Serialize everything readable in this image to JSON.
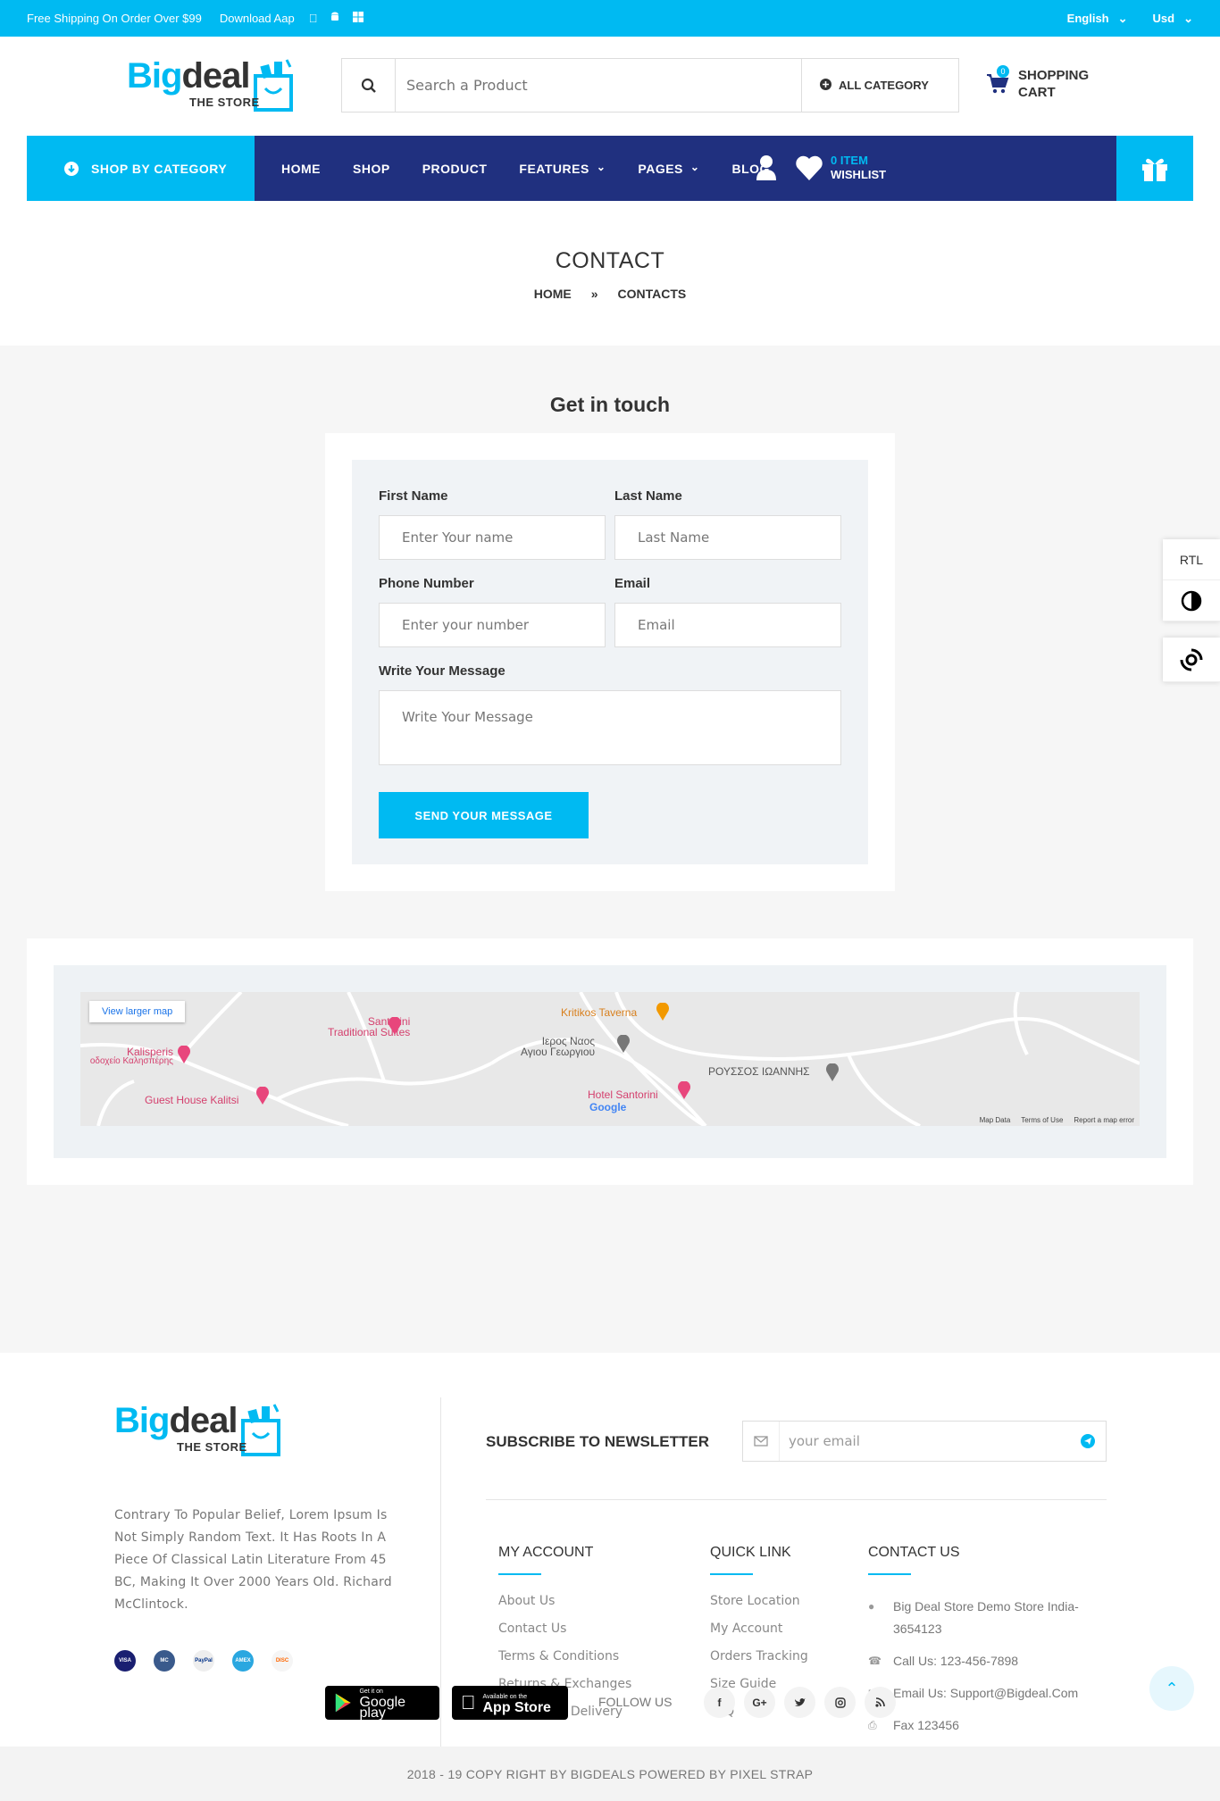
{
  "topbar": {
    "shipping": "Free Shipping On Order Over $99",
    "download": "Download Aap",
    "language": "English",
    "currency": "Usd"
  },
  "logo": {
    "big": "Big",
    "deal": "deal",
    "sub": "THE STORE"
  },
  "search": {
    "placeholder": "Search a Product",
    "category": "ALL CATEGORY"
  },
  "cart": {
    "count": "0",
    "line1": "SHOPPING",
    "line2": "CART"
  },
  "nav": {
    "shop_by_category": "SHOP BY CATEGORY",
    "items": [
      "HOME",
      "SHOP",
      "PRODUCT",
      "FEATURES",
      "PAGES",
      "BLOG"
    ],
    "wishlist_count": "0 ITEM",
    "wishlist_label": "WISHLIST"
  },
  "page": {
    "title": "CONTACT",
    "crumb_home": "HOME",
    "crumb_sep": "»",
    "crumb_current": "CONTACTS"
  },
  "form": {
    "heading": "Get in touch",
    "first_name_label": "First Name",
    "first_name_placeholder": "Enter Your name",
    "last_name_label": "Last Name",
    "last_name_placeholder": "Last Name",
    "phone_label": "Phone Number",
    "phone_placeholder": "Enter your number",
    "email_label": "Email",
    "email_placeholder": "Email",
    "message_label": "Write Your Message",
    "message_placeholder": "Write Your Message",
    "submit": "SEND YOUR MESSAGE"
  },
  "map": {
    "view_larger": "View larger map",
    "places": {
      "kritikos": "Kritikos Taverna",
      "santorini_trad_1": "Santorini",
      "santorini_trad_2": "Traditional Suites",
      "ieros_1": "Ιερος Ναος",
      "ieros_2": "Αγιου Γεωργιου",
      "kalisperis_1": "Kalisperis",
      "kalisperis_2": "οδοχείο Καλησπέρης",
      "roussos": "ΡΟΥΣΣΟΣ ΙΩΑΝΝΗΣ",
      "hotel_santorini": "Hotel Santorini",
      "guest_house": "Guest House Kalitsi"
    },
    "google": "Google",
    "credits": [
      "Map Data",
      "Terms of Use",
      "Report a map error"
    ]
  },
  "sidewidget": {
    "rtl": "RTL"
  },
  "footer": {
    "description": "Contrary To Popular Belief, Lorem Ipsum Is Not Simply Random Text. It Has Roots In A Piece Of Classical Latin Literature From 45 BC, Making It Over 2000 Years Old. Richard McClintock.",
    "payment_cards": [
      "VISA",
      "MC",
      "PayPal",
      "AMEX",
      "DISC"
    ],
    "newsletter_title": "SUBSCRIBE TO NEWSLETTER",
    "newsletter_placeholder": "your email",
    "my_account_title": "MY ACCOUNT",
    "my_account_links": [
      "About Us",
      "Contact Us",
      "Terms & Conditions",
      "Returns & Exchanges",
      "Shipping & Delivery"
    ],
    "quick_link_title": "QUICK LINK",
    "quick_links": [
      "Store Location",
      "My Account",
      "Orders Tracking",
      "Size Guide",
      "FAQ"
    ],
    "contact_title": "CONTACT US",
    "contact_address": "Big Deal Store Demo Store India-3654123",
    "contact_phone": "Call Us: 123-456-7898",
    "contact_email": "Email Us: Support@Bigdeal.Com",
    "contact_fax": "Fax 123456",
    "google_play_small": "Get it on",
    "google_play_large": "Google play",
    "app_store_small": "Available on the",
    "app_store_large": "App Store",
    "follow_us": "FOLLOW US",
    "social": [
      "f",
      "G+",
      "t",
      "ig",
      "rss"
    ],
    "copyright": "2018 - 19 COPY RIGHT BY BIGDEALS POWERED BY PIXEL STRAP"
  },
  "colors": {
    "accent": "#00baf2",
    "nav": "#20307f"
  }
}
